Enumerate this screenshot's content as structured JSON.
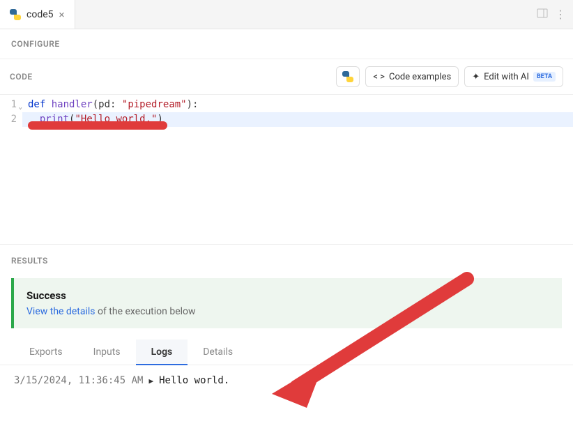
{
  "tab": {
    "title": "code5"
  },
  "sections": {
    "configure": "CONFIGURE",
    "code": "CODE",
    "results": "RESULTS"
  },
  "buttons": {
    "code_examples": "Code examples",
    "edit_ai": "Edit with AI",
    "beta": "BETA"
  },
  "code": {
    "line1": {
      "kw": "def",
      "fn": " handler",
      "p1": "(pd: ",
      "str": "\"pipedream\"",
      "p2": "):"
    },
    "line2": {
      "pad": "  ",
      "fn": "print",
      "p1": "(",
      "str": "\"Hello world.\"",
      "p2": ")"
    },
    "ln1": "1",
    "ln2": "2"
  },
  "success": {
    "title": "Success",
    "link": "View the details",
    "rest": " of the execution below"
  },
  "tabs": {
    "exports": "Exports",
    "inputs": "Inputs",
    "logs": "Logs",
    "details": "Details"
  },
  "log": {
    "timestamp": "3/15/2024, 11:36:45 AM",
    "message": "Hello world."
  }
}
